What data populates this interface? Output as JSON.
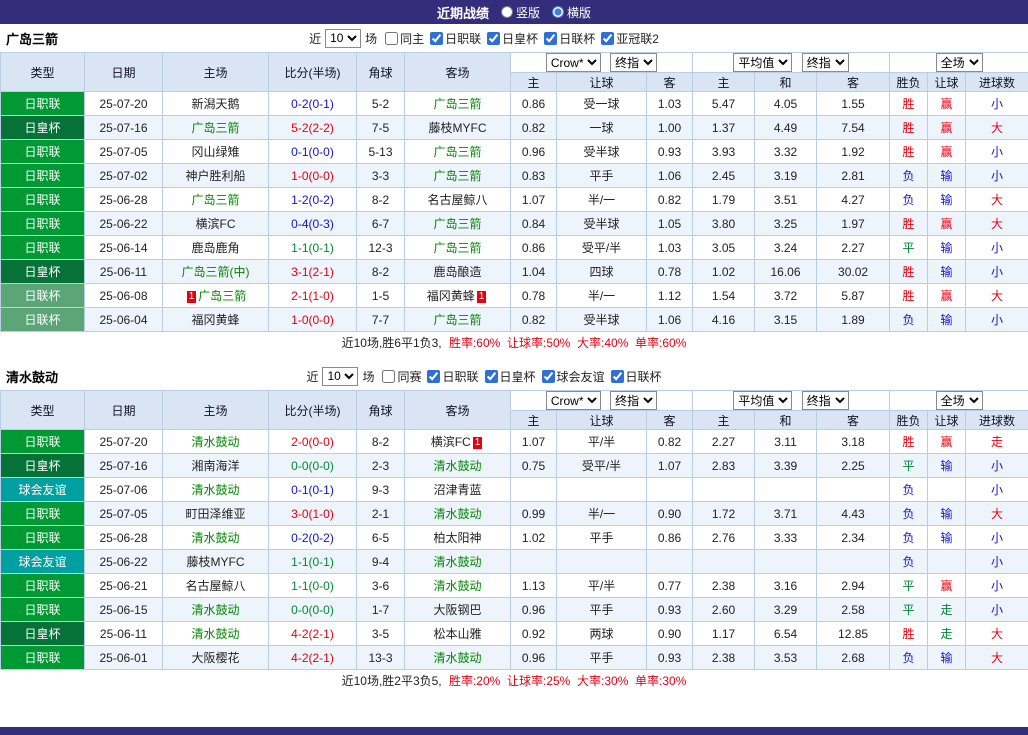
{
  "topbar": {
    "title": "近期战绩",
    "view_options": [
      {
        "label": "竖版",
        "selected": false
      },
      {
        "label": "横版",
        "selected": true
      }
    ]
  },
  "colors": {
    "topbar_bg": "#332d7b",
    "grid": "#b9cde4",
    "header_bg": "#d9e5f3",
    "row_alt_bg": "#edf4fb",
    "win_red": "#e60012",
    "lose_blue": "#1414cc",
    "draw_green": "#008833",
    "self_team_green": "#008800",
    "badge_bg": "#e60012",
    "league": {
      "日职联": "#009933",
      "日皇杯": "#067238",
      "日联杯": "#5ba577",
      "球会友谊": "#00a0a0"
    }
  },
  "sections": [
    {
      "team": "广岛三箭",
      "recent_filter": {
        "prefix": "近",
        "count": "10",
        "suffix": "场"
      },
      "filters": [
        {
          "label": "同主",
          "checked": false
        },
        {
          "label": "日职联",
          "checked": true
        },
        {
          "label": "日皇杯",
          "checked": true
        },
        {
          "label": "日联杯",
          "checked": true
        },
        {
          "label": "亚冠联2",
          "checked": true
        }
      ],
      "dropdowns": {
        "ah_group": [
          "Crow*",
          "终指"
        ],
        "eu_group": [
          "平均值",
          "终指"
        ],
        "scope_group": [
          "全场"
        ]
      },
      "columns": {
        "left": [
          "类型",
          "日期",
          "主场",
          "比分(半场)",
          "角球",
          "客场"
        ],
        "sub": [
          "主",
          "让球",
          "客",
          "主",
          "和",
          "客",
          "胜负",
          "让球",
          "进球数"
        ]
      },
      "rows": [
        {
          "league": "日职联",
          "date": "25-07-20",
          "home": {
            "name": "新潟天鹅",
            "self": false
          },
          "score": "0-2(0-1)",
          "outcome": "away",
          "corner": "5-2",
          "away": {
            "name": "广岛三箭",
            "self": true
          },
          "ah": [
            "0.86",
            "受一球",
            "1.03"
          ],
          "eu": [
            "5.47",
            "4.05",
            "1.55"
          ],
          "res": [
            [
              "胜",
              "win"
            ],
            [
              "赢",
              "win"
            ],
            [
              "小",
              "lose"
            ]
          ]
        },
        {
          "league": "日皇杯",
          "date": "25-07-16",
          "home": {
            "name": "广岛三箭",
            "self": true
          },
          "score": "5-2(2-2)",
          "outcome": "home",
          "corner": "7-5",
          "away": {
            "name": "藤枝MYFC",
            "self": false
          },
          "ah": [
            "0.82",
            "一球",
            "1.00"
          ],
          "eu": [
            "1.37",
            "4.49",
            "7.54"
          ],
          "res": [
            [
              "胜",
              "win"
            ],
            [
              "赢",
              "win"
            ],
            [
              "大",
              "win"
            ]
          ]
        },
        {
          "league": "日职联",
          "date": "25-07-05",
          "home": {
            "name": "冈山绿雉",
            "self": false
          },
          "score": "0-1(0-0)",
          "outcome": "away",
          "corner": "5-13",
          "away": {
            "name": "广岛三箭",
            "self": true
          },
          "ah": [
            "0.96",
            "受半球",
            "0.93"
          ],
          "eu": [
            "3.93",
            "3.32",
            "1.92"
          ],
          "res": [
            [
              "胜",
              "win"
            ],
            [
              "赢",
              "win"
            ],
            [
              "小",
              "lose"
            ]
          ]
        },
        {
          "league": "日职联",
          "date": "25-07-02",
          "home": {
            "name": "神户胜利船",
            "self": false
          },
          "score": "1-0(0-0)",
          "outcome": "home",
          "corner": "3-3",
          "away": {
            "name": "广岛三箭",
            "self": true
          },
          "ah": [
            "0.83",
            "平手",
            "1.06"
          ],
          "eu": [
            "2.45",
            "3.19",
            "2.81"
          ],
          "res": [
            [
              "负",
              "lose"
            ],
            [
              "输",
              "lose"
            ],
            [
              "小",
              "lose"
            ]
          ]
        },
        {
          "league": "日职联",
          "date": "25-06-28",
          "home": {
            "name": "广岛三箭",
            "self": true
          },
          "score": "1-2(0-2)",
          "outcome": "away",
          "corner": "8-2",
          "away": {
            "name": "名古屋鲸八",
            "self": false
          },
          "ah": [
            "1.07",
            "半/一",
            "0.82"
          ],
          "eu": [
            "1.79",
            "3.51",
            "4.27"
          ],
          "res": [
            [
              "负",
              "lose"
            ],
            [
              "输",
              "lose"
            ],
            [
              "大",
              "win"
            ]
          ]
        },
        {
          "league": "日职联",
          "date": "25-06-22",
          "home": {
            "name": "横滨FC",
            "self": false
          },
          "score": "0-4(0-3)",
          "outcome": "away",
          "corner": "6-7",
          "away": {
            "name": "广岛三箭",
            "self": true
          },
          "ah": [
            "0.84",
            "受半球",
            "1.05"
          ],
          "eu": [
            "3.80",
            "3.25",
            "1.97"
          ],
          "res": [
            [
              "胜",
              "win"
            ],
            [
              "赢",
              "win"
            ],
            [
              "大",
              "win"
            ]
          ]
        },
        {
          "league": "日职联",
          "date": "25-06-14",
          "home": {
            "name": "鹿岛鹿角",
            "self": false
          },
          "score": "1-1(0-1)",
          "outcome": "draw",
          "corner": "12-3",
          "away": {
            "name": "广岛三箭",
            "self": true
          },
          "ah": [
            "0.86",
            "受平/半",
            "1.03"
          ],
          "eu": [
            "3.05",
            "3.24",
            "2.27"
          ],
          "res": [
            [
              "平",
              "draw"
            ],
            [
              "输",
              "lose"
            ],
            [
              "小",
              "lose"
            ]
          ]
        },
        {
          "league": "日皇杯",
          "date": "25-06-11",
          "home": {
            "name": "广岛三箭(中)",
            "self": true
          },
          "score": "3-1(2-1)",
          "outcome": "home",
          "corner": "8-2",
          "away": {
            "name": "鹿岛酿造",
            "self": false
          },
          "ah": [
            "1.04",
            "四球",
            "0.78"
          ],
          "eu": [
            "1.02",
            "16.06",
            "30.02"
          ],
          "res": [
            [
              "胜",
              "win"
            ],
            [
              "输",
              "lose"
            ],
            [
              "小",
              "lose"
            ]
          ]
        },
        {
          "league": "日联杯",
          "date": "25-06-08",
          "home": {
            "name": "广岛三箭",
            "self": true,
            "badge": {
              "text": "1",
              "side": "left"
            }
          },
          "score": "2-1(1-0)",
          "outcome": "home",
          "corner": "1-5",
          "away": {
            "name": "福冈黄蜂",
            "self": false,
            "badge": {
              "text": "1",
              "side": "right"
            }
          },
          "ah": [
            "0.78",
            "半/一",
            "1.12"
          ],
          "eu": [
            "1.54",
            "3.72",
            "5.87"
          ],
          "res": [
            [
              "胜",
              "win"
            ],
            [
              "赢",
              "win"
            ],
            [
              "大",
              "win"
            ]
          ]
        },
        {
          "league": "日联杯",
          "date": "25-06-04",
          "home": {
            "name": "福冈黄蜂",
            "self": false
          },
          "score": "1-0(0-0)",
          "outcome": "home",
          "corner": "7-7",
          "away": {
            "name": "广岛三箭",
            "self": true
          },
          "ah": [
            "0.82",
            "受半球",
            "1.06"
          ],
          "eu": [
            "4.16",
            "3.15",
            "1.89"
          ],
          "res": [
            [
              "负",
              "lose"
            ],
            [
              "输",
              "lose"
            ],
            [
              "小",
              "lose"
            ]
          ]
        }
      ],
      "summary": {
        "record": "近10场,胜6平1负3, ",
        "stats": "胜率:60%  让球率:50%  大率:40%  单率:60%"
      }
    },
    {
      "team": "清水鼓动",
      "recent_filter": {
        "prefix": "近",
        "count": "10",
        "suffix": "场"
      },
      "filters": [
        {
          "label": "同赛",
          "checked": false
        },
        {
          "label": "日职联",
          "checked": true
        },
        {
          "label": "日皇杯",
          "checked": true
        },
        {
          "label": "球会友谊",
          "checked": true
        },
        {
          "label": "日联杯",
          "checked": true
        }
      ],
      "dropdowns": {
        "ah_group": [
          "Crow*",
          "终指"
        ],
        "eu_group": [
          "平均值",
          "终指"
        ],
        "scope_group": [
          "全场"
        ]
      },
      "columns": {
        "left": [
          "类型",
          "日期",
          "主场",
          "比分(半场)",
          "角球",
          "客场"
        ],
        "sub": [
          "主",
          "让球",
          "客",
          "主",
          "和",
          "客",
          "胜负",
          "让球",
          "进球数"
        ]
      },
      "rows": [
        {
          "league": "日职联",
          "date": "25-07-20",
          "home": {
            "name": "清水鼓动",
            "self": true
          },
          "score": "2-0(0-0)",
          "outcome": "home",
          "corner": "8-2",
          "away": {
            "name": "横滨FC",
            "self": false,
            "badge": {
              "text": "1",
              "side": "right"
            }
          },
          "ah": [
            "1.07",
            "平/半",
            "0.82"
          ],
          "eu": [
            "2.27",
            "3.11",
            "3.18"
          ],
          "res": [
            [
              "胜",
              "win"
            ],
            [
              "赢",
              "win"
            ],
            [
              "走",
              "win"
            ]
          ]
        },
        {
          "league": "日皇杯",
          "date": "25-07-16",
          "home": {
            "name": "湘南海洋",
            "self": false
          },
          "score": "0-0(0-0)",
          "outcome": "draw",
          "corner": "2-3",
          "away": {
            "name": "清水鼓动",
            "self": true
          },
          "ah": [
            "0.75",
            "受平/半",
            "1.07"
          ],
          "eu": [
            "2.83",
            "3.39",
            "2.25"
          ],
          "res": [
            [
              "平",
              "draw"
            ],
            [
              "输",
              "lose"
            ],
            [
              "小",
              "lose"
            ]
          ]
        },
        {
          "league": "球会友谊",
          "date": "25-07-06",
          "home": {
            "name": "清水鼓动",
            "self": true
          },
          "score": "0-1(0-1)",
          "outcome": "away",
          "corner": "9-3",
          "away": {
            "name": "沼津青蓝",
            "self": false
          },
          "ah": [
            "",
            "",
            ""
          ],
          "eu": [
            "",
            "",
            ""
          ],
          "res": [
            [
              "负",
              "lose"
            ],
            [
              "",
              ""
            ],
            [
              "小",
              "lose"
            ]
          ]
        },
        {
          "league": "日职联",
          "date": "25-07-05",
          "home": {
            "name": "町田泽维亚",
            "self": false
          },
          "score": "3-0(1-0)",
          "outcome": "home",
          "corner": "2-1",
          "away": {
            "name": "清水鼓动",
            "self": true
          },
          "ah": [
            "0.99",
            "半/一",
            "0.90"
          ],
          "eu": [
            "1.72",
            "3.71",
            "4.43"
          ],
          "res": [
            [
              "负",
              "lose"
            ],
            [
              "输",
              "lose"
            ],
            [
              "大",
              "win"
            ]
          ]
        },
        {
          "league": "日职联",
          "date": "25-06-28",
          "home": {
            "name": "清水鼓动",
            "self": true
          },
          "score": "0-2(0-2)",
          "outcome": "away",
          "corner": "6-5",
          "away": {
            "name": "柏太阳神",
            "self": false
          },
          "ah": [
            "1.02",
            "平手",
            "0.86"
          ],
          "eu": [
            "2.76",
            "3.33",
            "2.34"
          ],
          "res": [
            [
              "负",
              "lose"
            ],
            [
              "输",
              "lose"
            ],
            [
              "小",
              "lose"
            ]
          ]
        },
        {
          "league": "球会友谊",
          "date": "25-06-22",
          "home": {
            "name": "藤枝MYFC",
            "self": false
          },
          "score": "1-1(0-1)",
          "outcome": "draw",
          "corner": "9-4",
          "away": {
            "name": "清水鼓动",
            "self": true
          },
          "ah": [
            "",
            "",
            ""
          ],
          "eu": [
            "",
            "",
            ""
          ],
          "res": [
            [
              "负",
              "lose"
            ],
            [
              "",
              ""
            ],
            [
              "小",
              "lose"
            ]
          ]
        },
        {
          "league": "日职联",
          "date": "25-06-21",
          "home": {
            "name": "名古屋鲸八",
            "self": false
          },
          "score": "1-1(0-0)",
          "outcome": "draw",
          "corner": "3-6",
          "away": {
            "name": "清水鼓动",
            "self": true
          },
          "ah": [
            "1.13",
            "平/半",
            "0.77"
          ],
          "eu": [
            "2.38",
            "3.16",
            "2.94"
          ],
          "res": [
            [
              "平",
              "draw"
            ],
            [
              "赢",
              "win"
            ],
            [
              "小",
              "lose"
            ]
          ]
        },
        {
          "league": "日职联",
          "date": "25-06-15",
          "home": {
            "name": "清水鼓动",
            "self": true
          },
          "score": "0-0(0-0)",
          "outcome": "draw",
          "corner": "1-7",
          "away": {
            "name": "大阪钢巴",
            "self": false
          },
          "ah": [
            "0.96",
            "平手",
            "0.93"
          ],
          "eu": [
            "2.60",
            "3.29",
            "2.58"
          ],
          "res": [
            [
              "平",
              "draw"
            ],
            [
              "走",
              "draw"
            ],
            [
              "小",
              "lose"
            ]
          ]
        },
        {
          "league": "日皇杯",
          "date": "25-06-11",
          "home": {
            "name": "清水鼓动",
            "self": true
          },
          "score": "4-2(2-1)",
          "outcome": "home",
          "corner": "3-5",
          "away": {
            "name": "松本山雅",
            "self": false
          },
          "ah": [
            "0.92",
            "两球",
            "0.90"
          ],
          "eu": [
            "1.17",
            "6.54",
            "12.85"
          ],
          "res": [
            [
              "胜",
              "win"
            ],
            [
              "走",
              "draw"
            ],
            [
              "大",
              "win"
            ]
          ]
        },
        {
          "league": "日职联",
          "date": "25-06-01",
          "home": {
            "name": "大阪樱花",
            "self": false
          },
          "score": "4-2(2-1)",
          "outcome": "home",
          "corner": "13-3",
          "away": {
            "name": "清水鼓动",
            "self": true
          },
          "ah": [
            "0.96",
            "平手",
            "0.93"
          ],
          "eu": [
            "2.38",
            "3.53",
            "2.68"
          ],
          "res": [
            [
              "负",
              "lose"
            ],
            [
              "输",
              "lose"
            ],
            [
              "大",
              "win"
            ]
          ]
        }
      ],
      "summary": {
        "record": "近10场,胜2平3负5, ",
        "stats": "胜率:20%  让球率:25%  大率:30%  单率:30%"
      }
    }
  ]
}
